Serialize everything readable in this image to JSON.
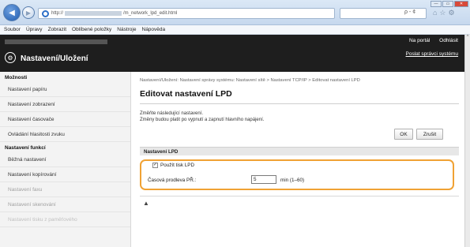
{
  "browser": {
    "url_host": "http://",
    "url_path": "/m_network_lpd_edit.html",
    "search_glyphs": "ρ - ¢",
    "window_controls": [
      "—",
      "▭",
      "✕"
    ]
  },
  "menubar": {
    "items": [
      "Soubor",
      "Úpravy",
      "Zobrazit",
      "Oblíbené položky",
      "Nástroje",
      "Nápověda"
    ]
  },
  "header": {
    "title": "Nastavení/Uložení",
    "portal_link": "Na portál",
    "logout_link": "Odhlásit",
    "mail_link": "Poslat správci systému"
  },
  "sidebar": {
    "section1": "Možnosti",
    "items1": [
      "Nastavení papíru",
      "Nastavení zobrazení",
      "Nastavení časovače",
      "Ovládání hlasitosti zvuku"
    ],
    "section2": "Nastavení funkcí",
    "items2": [
      "Běžná nastavení",
      "Nastavení kopírování",
      "Nastavení faxu",
      "Nastavení skenování",
      "Nastavení tisku z paměťového"
    ]
  },
  "main": {
    "breadcrumb": "Nastavení/Uložení: Nastavení správy systému: Nastavení sítě > Nastavení TCP/IP > Editovat nastavení LPD",
    "title": "Editovat nastavení LPD",
    "description_line1": "Změňte následující nastavení.",
    "description_line2": "Změny budou platit po vypnutí a zapnutí hlavního napájení.",
    "ok_label": "OK",
    "cancel_label": "Zrušit",
    "section_title": "Nastavení LPD",
    "checkbox_label": "Použít tisk LPD",
    "checkbox_checked": true,
    "timeout_label": "Časová prodleva PŘ.:",
    "timeout_value": "5",
    "timeout_unit": "min (1–60)",
    "top_link": "▲"
  },
  "colors": {
    "highlight": "#f0a234",
    "header_bg": "#1e1e1e"
  }
}
